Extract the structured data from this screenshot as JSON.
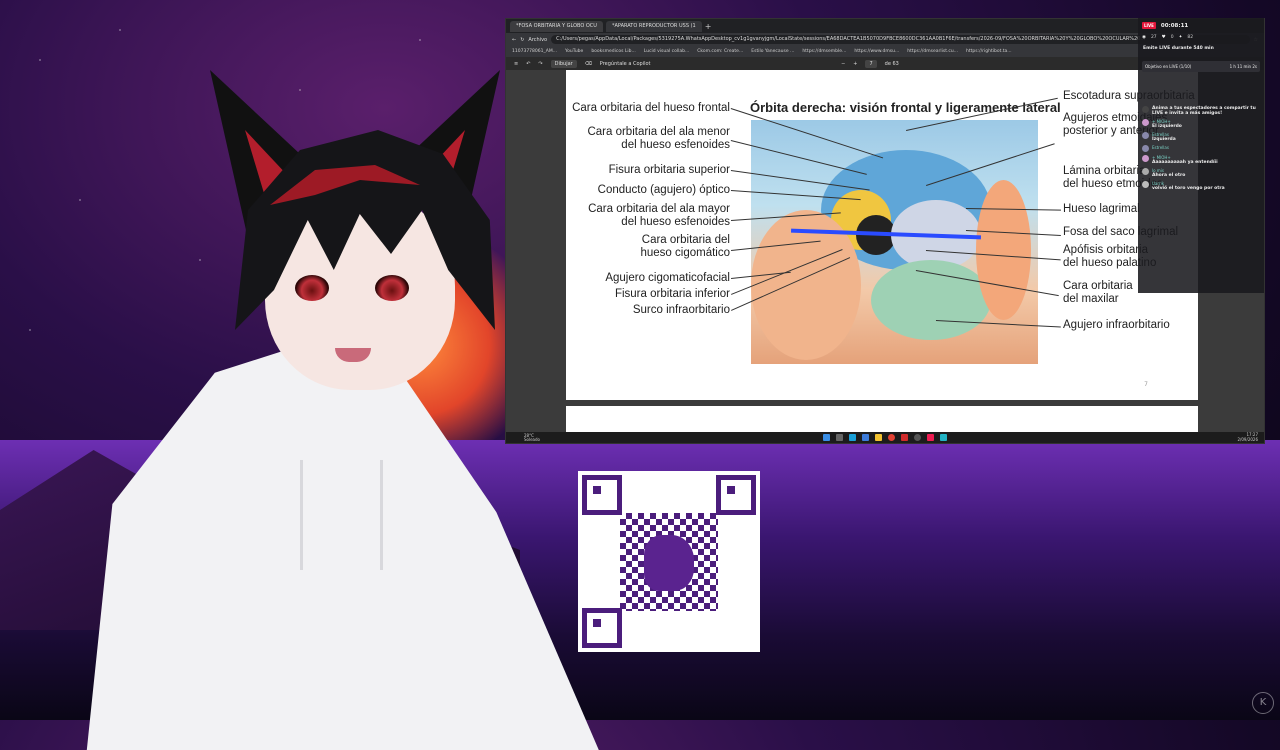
{
  "browser": {
    "tabs": [
      "*FOSA ORBITARIA Y GLOBO OCU",
      "*APARATO REPRODUCTOR USS (1"
    ],
    "url": "C:/Users/pegas/AppData/Local/Packages/5319275A.WhatsAppDesktop_cv1g1gvanyjgm/LocalState/sessions/EA68DACTEA1B5070D9FBCE8600DC361AA0B1F6E/transfers/2026-09/FOSA%20ORBITARIA%20Y%20GLOBO%20OCULAR%20...",
    "url_label": "Archivo",
    "bookmarks": [
      "11073778061_AM...",
      "YouTube",
      "booksmedicos Lib...",
      "Lucid visual collab...",
      "Ckom.com: Create...",
      "Estilo Yanecause ...",
      "https://dmsemble...",
      "https://www.dmsu...",
      "https://dmsearlist.cu...",
      "https://rightibot.ta..."
    ],
    "pdf_toolbar": {
      "draw": "Dibujar",
      "ask_copilot": "Pregúntale a Copilot",
      "page_of": "de 63",
      "zoom_minus": "−",
      "zoom_plus": "+",
      "page": "7"
    }
  },
  "document": {
    "figure_title": "Órbita derecha: visión frontal y ligeramente lateral",
    "left_labels": [
      "Cara orbitaria del hueso frontal",
      "Cara orbitaria del ala menor\ndel hueso esfenoides",
      "Fisura orbitaria superior",
      "Conducto (agujero) óptico",
      "Cara orbitaria del ala mayor\ndel hueso esfenoides",
      "Cara orbitaria del\nhueso cigomático",
      "Agujero cigomaticofacial",
      "Fisura orbitaria inferior",
      "Surco infraorbitario"
    ],
    "right_labels": [
      "Escotadura supraorbitaria",
      "Agujeros etmoidales\nposterior y anterior",
      "Lámina orbitaria\ndel hueso etmoides",
      "Hueso lagrimal",
      "Fosa del saco lagrimal",
      "Apófisis orbitaria\ndel hueso palatino",
      "Cara orbitaria\ndel maxilar",
      "Agujero infraorbitario"
    ],
    "page_number": "7"
  },
  "taskbar": {
    "weather_temp": "28°C",
    "weather_desc": "Soleado",
    "time": "17:27",
    "date": "2/09/2026"
  },
  "chat": {
    "live_badge": "LIVE",
    "timer": "00:08:11",
    "viewers": "27",
    "likes": "0",
    "gifts": "82",
    "title": "Emite LIVE durante 540 min",
    "goal_label": "Objetivo en LIVE (1/10)",
    "goal_time": "1 h 11 min 2s",
    "messages": [
      {
        "user": "",
        "text": "Anima a tus espectadores a compartir tu LIVE e invita a más amigos!"
      },
      {
        "user": "+ MIOH+",
        "text": "El izquierdo"
      },
      {
        "user": "Estrellas",
        "text": "Izquierda"
      },
      {
        "user": "Estrellas",
        "text": ""
      },
      {
        "user": "+ MIOH+",
        "text": "Aaaaaaaaaah ya entendíii"
      },
      {
        "user": "lo mis",
        "text": "Ahora el otro"
      },
      {
        "user": "Uarrik",
        "text": "volvió el toro vengo por otra"
      }
    ]
  },
  "overlay": {
    "watermark": "K"
  }
}
